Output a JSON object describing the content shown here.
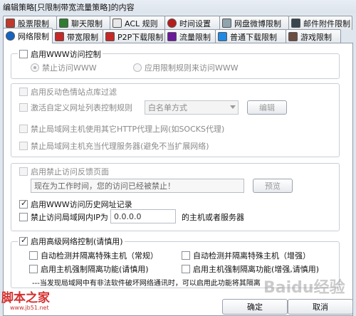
{
  "window": {
    "title": "编辑策略[只限制带宽流量策略]的内容"
  },
  "tabs_row1": [
    {
      "label": "股票限制",
      "icon": "stock-icon"
    },
    {
      "label": "聊天限制",
      "icon": "chat-icon"
    },
    {
      "label": "ACL 规则",
      "icon": "acl-icon"
    },
    {
      "label": "时间设置",
      "icon": "clock-icon"
    },
    {
      "label": "网盘微博限制",
      "icon": "cloud-icon"
    },
    {
      "label": "邮件附件限制",
      "icon": "mail-icon"
    }
  ],
  "tabs_row2": [
    {
      "label": "网络限制",
      "icon": "network-icon",
      "active": true
    },
    {
      "label": "带宽限制",
      "icon": "bandwidth-icon"
    },
    {
      "label": "P2P下载限制",
      "icon": "p2p-icon"
    },
    {
      "label": "流量限制",
      "icon": "traffic-icon"
    },
    {
      "label": "普通下载限制",
      "icon": "download-icon"
    },
    {
      "label": "游戏限制",
      "icon": "game-icon"
    }
  ],
  "www": {
    "enable_label": "启用WWW访问控制",
    "deny_label": "禁止访问WWW",
    "rules_label": "应用限制规则来访问WWW"
  },
  "url_filter": {
    "reverse_label": "启用反动色情站点库过滤",
    "custom_label": "激活自定义网址列表控制规则",
    "mode_value": "白名单方式",
    "edit_label": "编辑",
    "http_proxy_label": "禁止局域网主机使用其它HTTP代理上网(如SOCKS代理)",
    "proxy_server_label": "禁止局域网主机充当代理服务器(避免不当扩展网络)"
  },
  "feedback": {
    "enable_label": "启用禁止访问反馈页面",
    "message_value": "现在为工作时间，您的访问已经被禁止！",
    "preview_label": "预览"
  },
  "history": {
    "enable_label": "启用WWW访问历史网址记录",
    "lan_ip_label": "禁止访问局域网内IP为",
    "lan_ip_value": "0.0.0.0",
    "lan_ip_suffix": "的主机或者服务器"
  },
  "advanced": {
    "enable_label": "启用高级网络控制(请慎用)",
    "auto_normal": "自动检测并隔离特殊主机（常规）",
    "auto_enhanced": "自动检测并隔离特殊主机（增强）",
    "strong_1": "启用主机强制隔离功能(请慎用)",
    "strong_2": "启用主机强制隔离功能(增强,请慎用)",
    "note": "---当发现局域网中有非法软件破坏网络通讯时，可以启用此功能将其隔离"
  },
  "footer": {
    "ok_label": "确定",
    "cancel_label": "取消"
  },
  "watermarks": {
    "site_name": "脚本之家",
    "site_url": "www.jb51.net",
    "right_mark": "Baidu经验"
  }
}
